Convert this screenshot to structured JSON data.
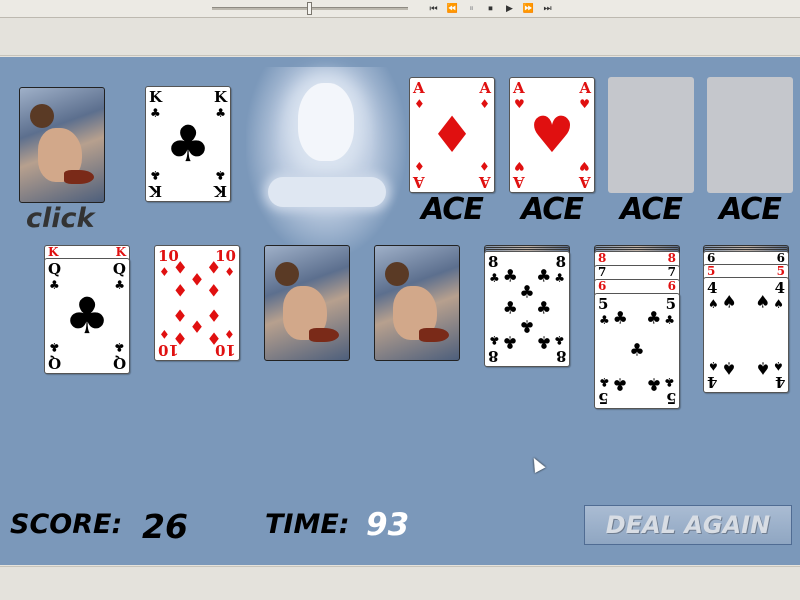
{
  "player": {
    "slider_value": 0.48,
    "controls": [
      {
        "icon": "skip-back-icon",
        "glyph": "⏮"
      },
      {
        "icon": "rewind-icon",
        "glyph": "⏪"
      },
      {
        "icon": "pause-icon",
        "glyph": "⏸"
      },
      {
        "icon": "stop-icon",
        "glyph": "⏹"
      },
      {
        "icon": "play-icon",
        "glyph": "▶"
      },
      {
        "icon": "fast-forward-icon",
        "glyph": "⏩"
      },
      {
        "icon": "skip-forward-icon",
        "glyph": "⏭"
      }
    ]
  },
  "stock": {
    "click_label": "click",
    "waste": {
      "rank": "K",
      "suit": "♣",
      "color": "black"
    }
  },
  "foundations": [
    {
      "rank": "A",
      "suit": "♦",
      "color": "red",
      "label": "ACE",
      "filled": true
    },
    {
      "rank": "A",
      "suit": "♥",
      "color": "red",
      "label": "ACE",
      "filled": true
    },
    {
      "label": "ACE",
      "filled": false
    },
    {
      "label": "ACE",
      "filled": false
    }
  ],
  "tableau": [
    {
      "top": {
        "rank": "Q",
        "suit": "♣",
        "color": "black"
      },
      "under": [
        {
          "rank": "K",
          "suit": "♥",
          "color": "red"
        }
      ],
      "backs": 0
    },
    {
      "top": {
        "rank": "10",
        "suit": "♦",
        "color": "red"
      },
      "under": [],
      "backs": 0
    },
    {
      "top": null,
      "under": [],
      "backs": 1
    },
    {
      "top": null,
      "under": [],
      "backs": 1
    },
    {
      "top": {
        "rank": "8",
        "suit": "♣",
        "color": "black"
      },
      "under": [],
      "backs": 3
    },
    {
      "top": {
        "rank": "5",
        "suit": "♣",
        "color": "black"
      },
      "under": [
        {
          "rank": "8",
          "suit": "♥",
          "color": "red"
        },
        {
          "rank": "7",
          "suit": "♣",
          "color": "black"
        },
        {
          "rank": "6",
          "suit": "♦",
          "color": "red"
        }
      ],
      "backs": 3
    },
    {
      "top": {
        "rank": "4",
        "suit": "♠",
        "color": "black"
      },
      "under": [
        {
          "rank": "6",
          "suit": "♠",
          "color": "black"
        },
        {
          "rank": "5",
          "suit": "♥",
          "color": "red"
        }
      ],
      "backs": 3
    }
  ],
  "status": {
    "score_label": "SCORE:",
    "score_value": "26",
    "time_label": "TIME:",
    "time_value": "93"
  },
  "buttons": {
    "deal_again": "DEAL AGAIN"
  },
  "colors": {
    "felt": "#7b98ba",
    "red_suit": "#e01010",
    "black_suit": "#000000",
    "time_value": "#ffffff"
  }
}
